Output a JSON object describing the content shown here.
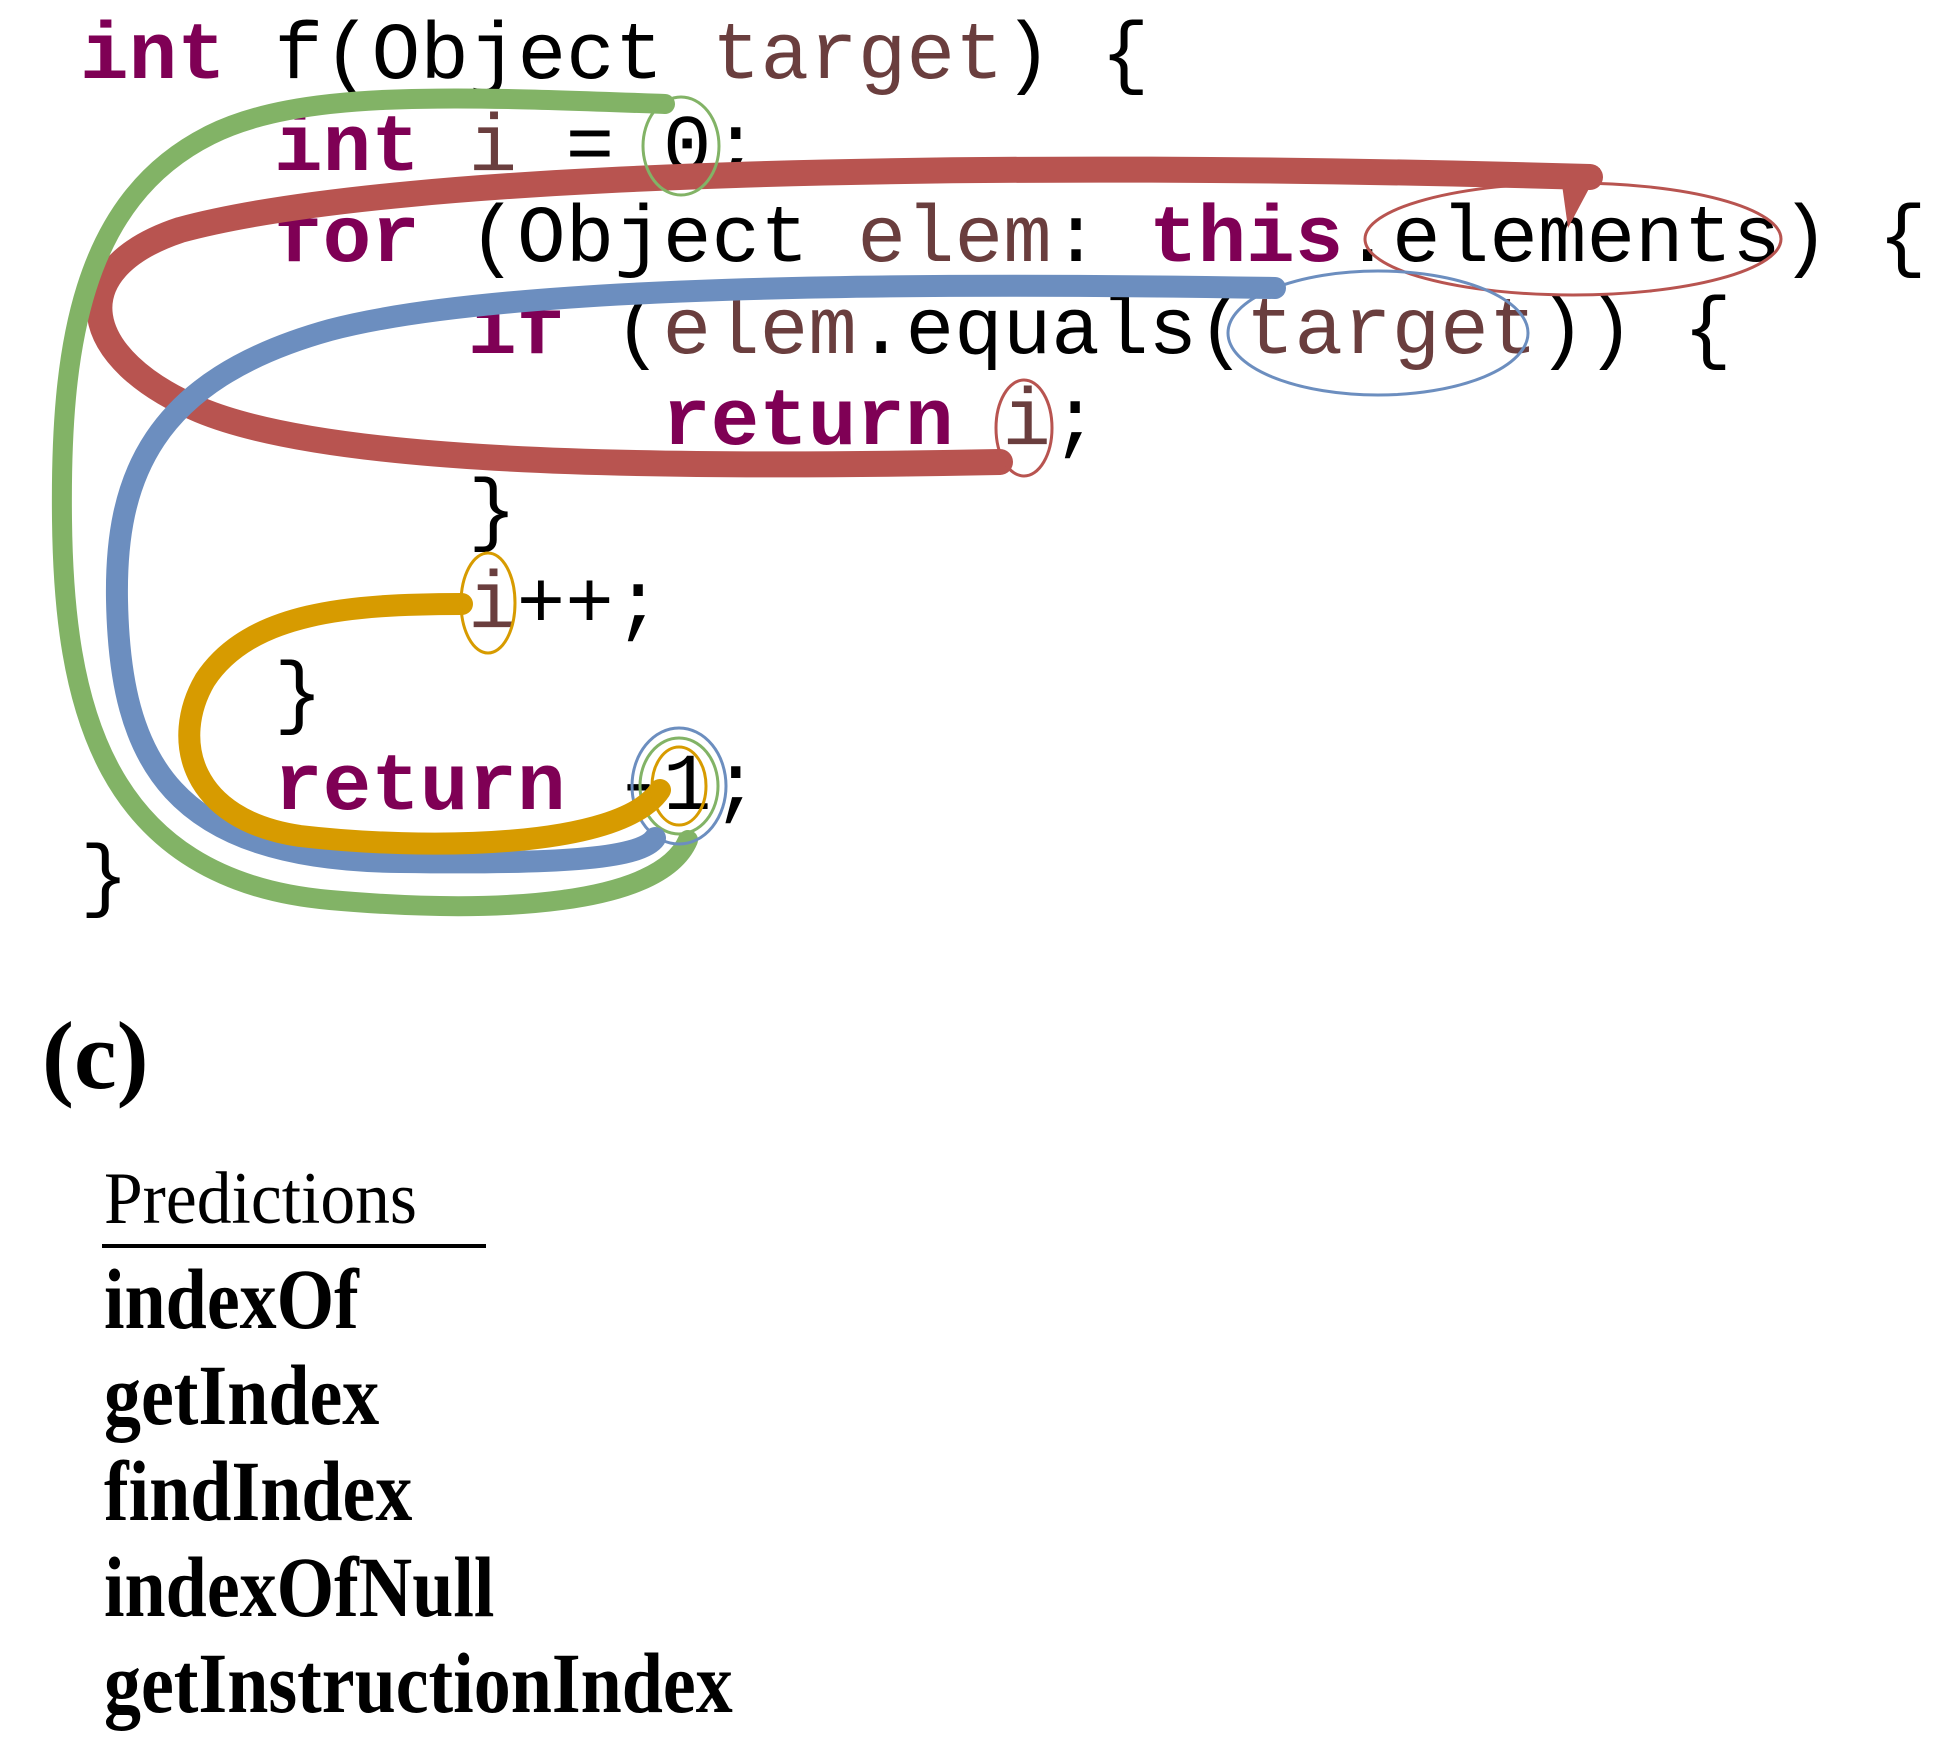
{
  "code": {
    "lines": [
      [
        {
          "t": "int",
          "c": "kw"
        },
        {
          "t": " f(Object ",
          "c": "plain"
        },
        {
          "t": "target",
          "c": "var"
        },
        {
          "t": ") {",
          "c": "plain"
        }
      ],
      [
        {
          "t": "int",
          "c": "kw"
        },
        {
          "t": " ",
          "c": "plain"
        },
        {
          "t": "i",
          "c": "var"
        },
        {
          "t": " = 0;",
          "c": "plain"
        }
      ],
      [
        {
          "t": "for",
          "c": "kw"
        },
        {
          "t": " (Object ",
          "c": "plain"
        },
        {
          "t": "elem",
          "c": "var"
        },
        {
          "t": ": ",
          "c": "plain"
        },
        {
          "t": "this",
          "c": "kw"
        },
        {
          "t": ".elements) {",
          "c": "plain"
        }
      ],
      [
        {
          "t": "if",
          "c": "kw"
        },
        {
          "t": " (",
          "c": "plain"
        },
        {
          "t": "elem",
          "c": "var"
        },
        {
          "t": ".equals(",
          "c": "plain"
        },
        {
          "t": "target",
          "c": "var"
        },
        {
          "t": ")) {",
          "c": "plain"
        }
      ],
      [
        {
          "t": "return",
          "c": "kw"
        },
        {
          "t": " ",
          "c": "plain"
        },
        {
          "t": "i",
          "c": "var"
        },
        {
          "t": ";",
          "c": "plain"
        }
      ],
      [
        {
          "t": "}",
          "c": "plain"
        }
      ],
      [
        {
          "t": "i",
          "c": "var"
        },
        {
          "t": "++;",
          "c": "plain"
        }
      ],
      [
        {
          "t": "}",
          "c": "plain"
        }
      ],
      [
        {
          "t": "return",
          "c": "kw"
        },
        {
          "t": " -1;",
          "c": "plain"
        }
      ],
      [
        {
          "t": "}",
          "c": "plain"
        }
      ]
    ]
  },
  "highlights": {
    "colors": {
      "green": "#82B366",
      "red": "#B85450",
      "blue": "#6C8EBF",
      "orange": "#D79B00"
    },
    "edges": [
      {
        "color": "green",
        "from_token": "0",
        "to_token": "1 (return -1)"
      },
      {
        "color": "red",
        "from_token": "elements",
        "to_token": "i (return i)"
      },
      {
        "color": "blue",
        "from_token": "target",
        "to_token": "1 (return -1)"
      },
      {
        "color": "orange",
        "from_token": "i (i++)",
        "to_token": "1 (return -1)"
      }
    ]
  },
  "panel_label": "(c)",
  "predictions": {
    "header": "Predictions",
    "items": [
      "indexOf",
      "getIndex",
      "findIndex",
      "indexOfNull",
      "getInstructionIndex"
    ]
  }
}
